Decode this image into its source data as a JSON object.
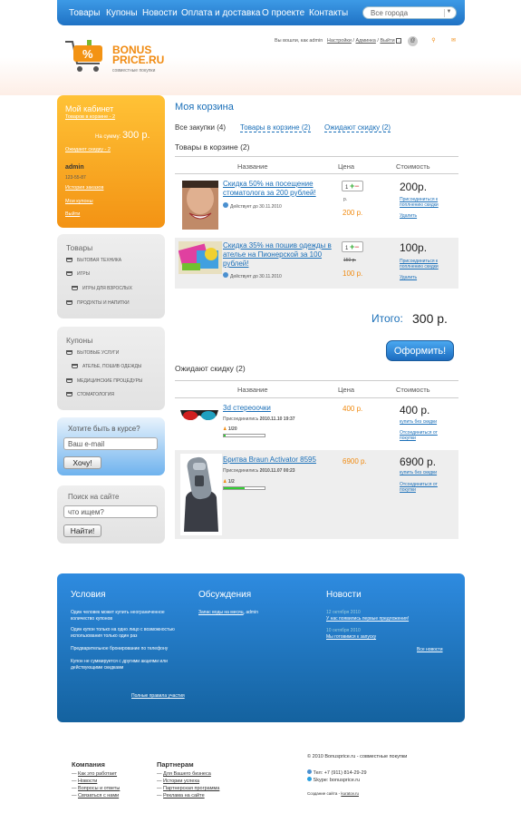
{
  "nav": {
    "items": [
      "Товары",
      "Купоны",
      "Новости",
      "Оплата и доставка",
      "О проекте",
      "Контакты"
    ],
    "city": "Все города"
  },
  "logo": {
    "line1": "BONUS",
    "line2": "PRICE.RU",
    "tagline": "совместные покупки"
  },
  "topbar": {
    "logged_as": "Вы вошли, как",
    "user": "admin",
    "settings": "Настройки",
    "admin": "Админка",
    "logout": "Выйти"
  },
  "cabinet": {
    "title": "Мой кабинет",
    "in_cart": "Товаров в корзине - 2",
    "sum_label": "На сумму:",
    "sum_value": "300 р.",
    "waiting": "Ожидают скидку - 2",
    "user": "admin",
    "date": "123-55-87",
    "history": "История заказов",
    "my_coupons": "Мои купоны",
    "exit": "Выйти"
  },
  "goods": {
    "title": "Товары",
    "items": [
      "Бытовая техника",
      "Игры",
      "Игры для взрослых",
      "Продукты и напитки"
    ]
  },
  "coupons": {
    "title": "Купоны",
    "items": [
      "Бытовые услуги",
      "Ателье, пошив одежды",
      "Медицинские процедуры",
      "Стоматология"
    ]
  },
  "subscribe": {
    "title": "Хотите быть в курсе?",
    "placeholder": "Ваш e-mail",
    "button": "Хочу!"
  },
  "search": {
    "title": "Поиск на сайте",
    "placeholder": "что ищем?",
    "button": "Найти!"
  },
  "main": {
    "title": "Моя корзина",
    "tabs": [
      "Все закупки",
      "Товары в корзине (2)",
      "Ожидают скидку (2)"
    ],
    "all_count": "(4)",
    "cart_heading": "Товары в корзине (2)",
    "headers": {
      "name": "Название",
      "price": "Цена",
      "cost": "Стоимость"
    },
    "cart_items": [
      {
        "name": "Скидка 50% на посещение стоматолога за 200 рублей!",
        "valid": "Действует до 30.11.2010",
        "qty": "1",
        "old_price": "р.",
        "price": "200 р.",
        "cost": "200р.",
        "join": "Присоединиться к поплнению скидки",
        "delete": "Удалить"
      },
      {
        "name": "Скидка 35% на пошив одежды в ателье на Пионерской за 100 рублей!",
        "valid": "Действует до 30.11.2010",
        "qty": "1",
        "old_price": "150 р.",
        "price": "100 р.",
        "cost": "100р.",
        "join": "Присоединиться к поплнению скидки",
        "delete": "Удалить"
      }
    ],
    "total_label": "Итого:",
    "total_value": "300 р.",
    "checkout": "Оформить!",
    "wait_heading": "Ожидают скидку (2)",
    "wait_items": [
      {
        "name": "3d стереоочки",
        "joined_label": "Присоединились",
        "joined": "2010.11.10 19:37",
        "progress_text": "1/20",
        "progress": 0.05,
        "price": "400 р.",
        "cost": "400 р.",
        "buy": "купить без скидки",
        "unsubscribe": "Отсоединиться от покупки"
      },
      {
        "name": "Бритва Braun Activator 8595",
        "joined_label": "Присоединились",
        "joined": "2010.11.07 00:23",
        "progress_text": "1/2",
        "progress": 0.5,
        "price": "6900 р.",
        "cost": "6900 р.",
        "buy": "купить без скидки",
        "unsubscribe": "Отсоединиться от покупки"
      }
    ]
  },
  "footer": {
    "terms_title": "Условия",
    "terms": [
      "Один человек может купить неограниченное количество купонов",
      "Один купон только на одно лицо с возможностью использования только один раз",
      "Предварительное бронирование по телефону",
      "Купон не суммируется с другими акциями или действующими скидками"
    ],
    "full_rules": "Полные правила участия",
    "disc_title": "Обсуждения",
    "disc_item": "Запас воды на месяц",
    "disc_user": "admin",
    "news_title": "Новости",
    "news": [
      {
        "date": "12 октября 2010",
        "text": "У нас появились первые предложения!"
      },
      {
        "date": "10 октября 2010",
        "text": "Мы готовимся к запуску"
      }
    ],
    "all_news": "Все новости"
  },
  "bottom": {
    "company_title": "Компания",
    "company": [
      "Как это работает",
      "Новости",
      "Вопросы и ответы",
      "Связаться с нами"
    ],
    "partners_title": "Партнерам",
    "partners": [
      "Для Вашего бизнеса",
      "Истории успеха",
      "Партнерская программа",
      "Реклама на сайте"
    ],
    "copyright": "© 2010 Bonusprice.ru - совместные покупки",
    "phone": "Тел: +7 (911) 814-29-29",
    "skype": "Skype: bonusprice.ru",
    "made": "Создание сайта - ",
    "made_link": "kuratov.ru"
  }
}
